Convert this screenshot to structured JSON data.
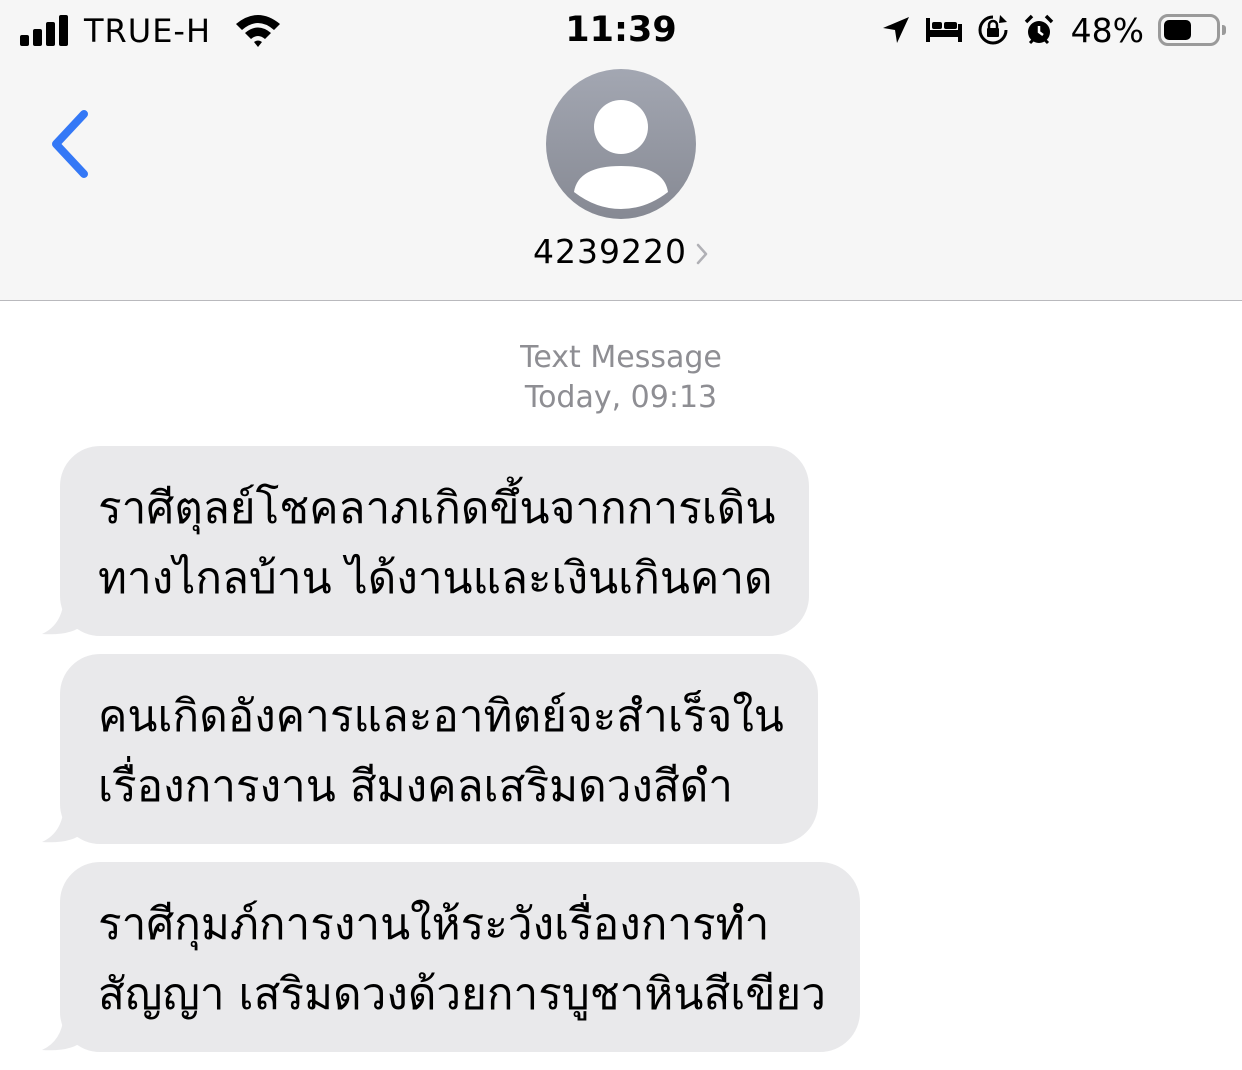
{
  "status_bar": {
    "carrier": "TRUE-H",
    "time": "11:39",
    "battery_percent": "48%",
    "battery_level": 0.48,
    "icons": [
      "signal-icon",
      "wifi-icon",
      "location-arrow-icon",
      "bed-icon",
      "rotation-lock-icon",
      "alarm-icon",
      "battery-icon"
    ]
  },
  "header": {
    "back_icon": "chevron-left-icon",
    "avatar_icon": "person-silhouette-icon",
    "contact_number": "4239220",
    "detail_icon": "chevron-right-icon"
  },
  "thread": {
    "message_type": "Text Message",
    "timestamp": "Today, 09:13",
    "messages": [
      {
        "lines": [
          "ราศีตุลย์โชคลาภเกิดขึ้นจากการเดิน",
          "ทางไกลบ้าน ได้งานและเงินเกินคาด"
        ]
      },
      {
        "lines": [
          "คนเกิดอังคารและอาทิตย์จะสำเร็จใน",
          "เรื่องการงาน สีมงคลเสริมดวงสีดำ"
        ]
      },
      {
        "lines": [
          "ราศีกุมภ์การงานให้ระวังเรื่องการทำ",
          "สัญญา เสริมดวงด้วยการบูชาหินสีเขียว"
        ]
      }
    ]
  },
  "colors": {
    "accent": "#3478f6",
    "header_bg": "#f6f6f6",
    "bubble_bg": "#e9e9eb",
    "meta_text": "#8e8e93",
    "avatar_gradient_top": "#a3a7b2",
    "avatar_gradient_bottom": "#868993"
  }
}
